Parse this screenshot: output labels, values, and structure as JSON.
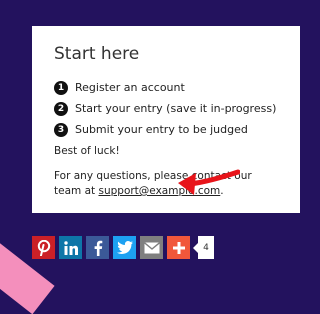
{
  "card": {
    "title": "Start here",
    "steps": [
      {
        "number": "1",
        "label": "Register an account"
      },
      {
        "number": "2",
        "label": "Start your entry (save it in-progress)"
      },
      {
        "number": "3",
        "label": "Submit your entry to be judged"
      }
    ],
    "luck": "Best of luck!",
    "contact_text": "For any questions, please contact our team at",
    "contact_email": "support@example.com",
    "contact_suffix": "."
  },
  "share": {
    "buttons": [
      {
        "name": "pinterest",
        "icon": "pinterest-icon",
        "color": "#cb2027"
      },
      {
        "name": "linkedin",
        "icon": "linkedin-icon",
        "color": "#0e76a8"
      },
      {
        "name": "facebook",
        "icon": "facebook-icon",
        "color": "#3b5998"
      },
      {
        "name": "twitter",
        "icon": "twitter-icon",
        "color": "#1da1f2"
      },
      {
        "name": "email",
        "icon": "envelope-icon",
        "color": "#7f7f7f"
      },
      {
        "name": "more",
        "icon": "plus-icon",
        "color": "#f1573b"
      }
    ],
    "count": "4"
  },
  "colors": {
    "background": "#23125e",
    "accent_stripe": "#f48fbc",
    "arrow": "#e8141a"
  }
}
